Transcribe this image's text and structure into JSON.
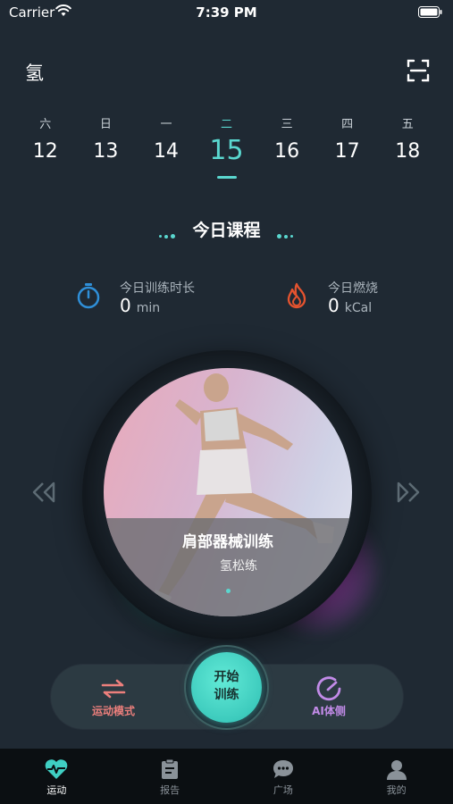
{
  "status_bar": {
    "carrier": "Carrier",
    "time": "7:39 PM"
  },
  "header": {
    "logo": "氢",
    "scan_icon": "scan-icon"
  },
  "calendar": {
    "days": [
      {
        "weekday": "六",
        "date": "12",
        "active": false
      },
      {
        "weekday": "日",
        "date": "13",
        "active": false
      },
      {
        "weekday": "一",
        "date": "14",
        "active": false
      },
      {
        "weekday": "二",
        "date": "15",
        "active": true
      },
      {
        "weekday": "三",
        "date": "16",
        "active": false
      },
      {
        "weekday": "四",
        "date": "17",
        "active": false
      },
      {
        "weekday": "五",
        "date": "18",
        "active": false
      }
    ]
  },
  "section": {
    "title": "今日课程"
  },
  "stats": {
    "duration": {
      "label": "今日训练时长",
      "value": "0",
      "unit": "min",
      "icon": "stopwatch-icon"
    },
    "burn": {
      "label": "今日燃烧",
      "value": "0",
      "unit": "kCal",
      "icon": "flame-icon"
    }
  },
  "course": {
    "name": "肩部器械训练",
    "subtitle": "氢松练"
  },
  "actions": {
    "mode_label": "运动模式",
    "start_line1": "开始",
    "start_line2": "训练",
    "ai_label": "AI体侧"
  },
  "tabs": [
    {
      "label": "运动",
      "icon": "heartbeat-icon",
      "active": true
    },
    {
      "label": "报告",
      "icon": "clipboard-icon",
      "active": false
    },
    {
      "label": "广场",
      "icon": "chat-bubble-icon",
      "active": false
    },
    {
      "label": "我的",
      "icon": "person-icon",
      "active": false
    }
  ],
  "colors": {
    "background": "#1f2933",
    "accent": "#5ad7cf",
    "mode": "#ec7f7c",
    "ai": "#c28be8",
    "stopwatch": "#2f8fd8",
    "flame": "#e5532f"
  }
}
